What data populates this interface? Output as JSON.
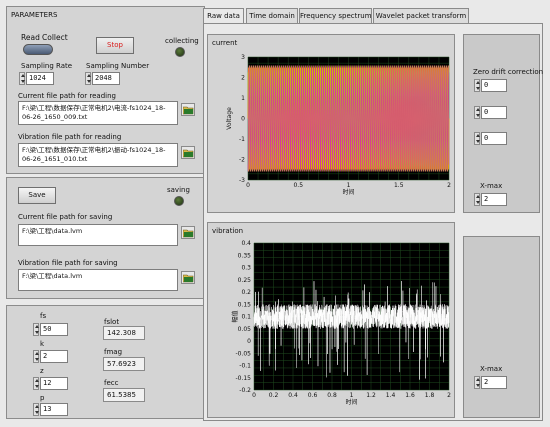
{
  "params": {
    "title": "PARAMETERS",
    "read_label": "Read",
    "collect_label": "Collect",
    "stop_label": "Stop",
    "collecting_label": "collecting",
    "sampling_rate_label": "Sampling Rate",
    "sampling_rate": "1024",
    "sampling_number_label": "Sampling Number",
    "sampling_number": "2048",
    "current_read_label": "Current file path for reading",
    "current_read_path": "F:\\梁\\工程\\数据保存\\正常电机2\\电流-fs1024_18-06-26_1650_009.txt",
    "vibration_read_label": "Vibration file path for reading",
    "vibration_read_path": "F:\\梁\\工程\\数据保存\\正常电机2\\振动-fs1024_18-06-26_1651_010.txt"
  },
  "save": {
    "save_label": "Save",
    "saving_label": "saving",
    "current_save_label": "Current file path for saving",
    "current_save_path": "F:\\梁\\工程\\data.lvm",
    "vibration_save_label": "Vibration file path for saving",
    "vibration_save_path": "F:\\梁\\工程\\data.lvm"
  },
  "calc": {
    "fs_label": "fs",
    "fs": "50",
    "k_label": "k",
    "k": "2",
    "z_label": "z",
    "z": "12",
    "p_label": "p",
    "p": "13",
    "fslot_label": "fslot",
    "fslot": "142.308",
    "fmag_label": "fmag",
    "fmag": "57.6923",
    "fecc_label": "fecc",
    "fecc": "61.5385"
  },
  "tabs": [
    "Raw data",
    "Time domain",
    "Frequency spectrum",
    "Wavelet packet transform"
  ],
  "current_panel": {
    "title": "current",
    "zero_drift_label": "Zero drift correction",
    "zero_values": [
      "0",
      "0",
      "0"
    ],
    "xmax_label": "X-max",
    "xmax": "2"
  },
  "vibration_panel": {
    "title": "vibration",
    "xmax_label": "X-max",
    "xmax": "2"
  },
  "chart_data": [
    {
      "type": "line",
      "title": "current",
      "xlabel": "时间",
      "ylabel": "Voltage",
      "xlim": [
        0,
        2
      ],
      "ylim": [
        -3,
        3
      ],
      "xticks": [
        "0",
        "0.5",
        "1",
        "1.5",
        "2"
      ],
      "yticks": [
        "3",
        "2",
        "1",
        "0",
        "-1",
        "-2",
        "-3"
      ],
      "series": [
        {
          "amplitude": 2.6,
          "frequency_hz": 50,
          "phase_deg": 0,
          "color": "#ff8c00"
        },
        {
          "amplitude": 2.6,
          "frequency_hz": 50,
          "phase_deg": 120,
          "color": "#b8cc10"
        },
        {
          "amplitude": 2.6,
          "frequency_hz": 50,
          "phase_deg": 240,
          "color": "#d83a9a"
        }
      ],
      "background": "#000000",
      "grid": true
    },
    {
      "type": "line",
      "title": "vibration",
      "xlabel": "时间",
      "ylabel": "幅值",
      "xlim": [
        0,
        2
      ],
      "ylim": [
        -0.2,
        0.4
      ],
      "xticks": [
        "0",
        "0.2",
        "0.4",
        "0.6",
        "0.8",
        "1",
        "1.2",
        "1.4",
        "1.6",
        "1.8",
        "2"
      ],
      "yticks": [
        "0.4",
        "0.35",
        "0.3",
        "0.25",
        "0.2",
        "0.15",
        "0.1",
        "0.05",
        "0",
        "-0.05",
        "-0.1",
        "-0.15",
        "-0.2"
      ],
      "series": [
        {
          "mean": 0.1,
          "spread": 0.05,
          "spike_max": 0.25,
          "spike_min": -0.16,
          "color": "#ffffff"
        }
      ],
      "background": "#000000",
      "grid": true
    }
  ]
}
